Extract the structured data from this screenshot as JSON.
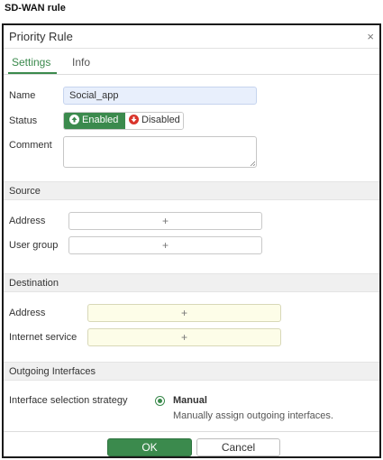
{
  "caption": "SD-WAN rule",
  "dialog": {
    "title": "Priority Rule",
    "close_glyph": "×"
  },
  "tabs": [
    {
      "label": "Settings",
      "active": true
    },
    {
      "label": "Info",
      "active": false
    }
  ],
  "form": {
    "name_label": "Name",
    "name_value": "Social_app",
    "status_label": "Status",
    "status_enabled": "Enabled",
    "status_disabled": "Disabled",
    "status_selected": "Enabled",
    "comment_label": "Comment",
    "comment_value": ""
  },
  "source": {
    "title": "Source",
    "address_label": "Address",
    "user_group_label": "User group",
    "add_glyph": "+"
  },
  "destination": {
    "title": "Destination",
    "address_label": "Address",
    "internet_service_label": "Internet service",
    "add_glyph": "+"
  },
  "outgoing": {
    "title": "Outgoing Interfaces",
    "strategy_label": "Interface selection strategy",
    "strategy_value": "Manual",
    "strategy_desc": "Manually assign outgoing interfaces."
  },
  "footer": {
    "ok_label": "OK",
    "cancel_label": "Cancel"
  },
  "colors": {
    "accent": "#3b8a4d",
    "disabled_icon": "#d9342b",
    "name_field_bg": "#e8effc",
    "destination_field_bg": "#fdfde8"
  },
  "icons": {
    "enabled": "arrow-up-circle-icon",
    "disabled": "arrow-down-circle-icon",
    "close": "close-icon",
    "resize": "resize-grip-icon"
  }
}
